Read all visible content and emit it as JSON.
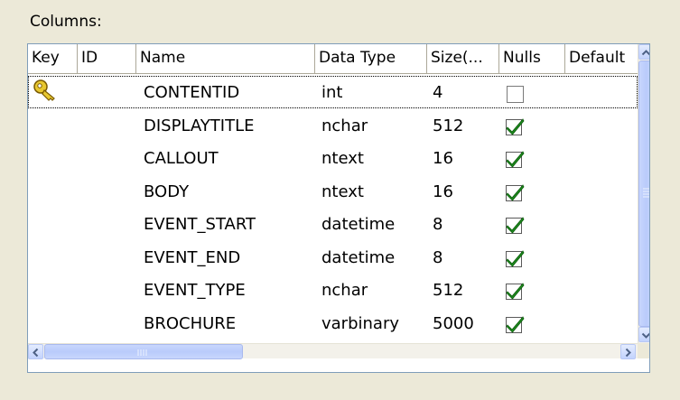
{
  "section_label": "Columns:",
  "headers": [
    "Key",
    "ID",
    "Name",
    "Data Type",
    "Size(...",
    "Nulls",
    "Default"
  ],
  "rows": [
    {
      "key": true,
      "name": "CONTENTID",
      "type": "int",
      "size": "4",
      "nulls": false
    },
    {
      "key": false,
      "name": "DISPLAYTITLE",
      "type": "nchar",
      "size": "512",
      "nulls": true
    },
    {
      "key": false,
      "name": "CALLOUT",
      "type": "ntext",
      "size": "16",
      "nulls": true
    },
    {
      "key": false,
      "name": "BODY",
      "type": "ntext",
      "size": "16",
      "nulls": true
    },
    {
      "key": false,
      "name": "EVENT_START",
      "type": "datetime",
      "size": "8",
      "nulls": true
    },
    {
      "key": false,
      "name": "EVENT_END",
      "type": "datetime",
      "size": "8",
      "nulls": true
    },
    {
      "key": false,
      "name": "EVENT_TYPE",
      "type": "nchar",
      "size": "512",
      "nulls": true
    },
    {
      "key": false,
      "name": "BROCHURE",
      "type": "varbinary",
      "size": "5000",
      "nulls": true
    }
  ],
  "icons": {
    "key": "key-icon",
    "check": "checkmark-icon",
    "scroll_up": "arrow-up-icon",
    "scroll_down": "arrow-down-icon",
    "scroll_left": "arrow-left-icon",
    "scroll_right": "arrow-right-icon"
  },
  "colors": {
    "window_bg": "#ECE9D8",
    "check_green": "#1E8A1E",
    "scrollbar": "#C3D3FD"
  }
}
